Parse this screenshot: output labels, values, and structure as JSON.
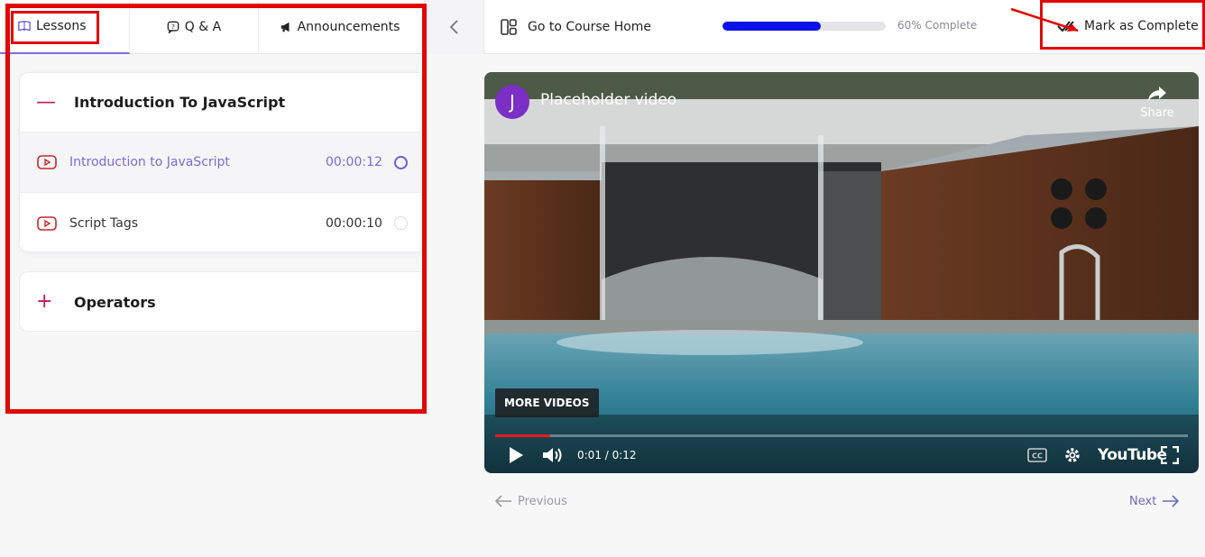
{
  "tabs": [
    {
      "label": "Lessons",
      "icon": "book-icon"
    },
    {
      "label": "Q & A",
      "icon": "chat-icon"
    },
    {
      "label": "Announcements",
      "icon": "megaphone-icon"
    }
  ],
  "header": {
    "collapse_icon": "chevron-left-icon",
    "course_home_label": "Go to Course Home",
    "course_home_icon": "layout-icon",
    "progress_percent": 60,
    "progress_text": "60% Complete",
    "mark_complete_label": "Mark as Complete",
    "mark_complete_icon": "check-icon"
  },
  "sections": [
    {
      "title": "Introduction To JavaScript",
      "expanded_sign": "—",
      "lessons": [
        {
          "title": "Introduction to JavaScript",
          "duration": "00:00:12",
          "active": true
        },
        {
          "title": "Script Tags",
          "duration": "00:00:10",
          "active": false
        }
      ]
    },
    {
      "title": "Operators",
      "collapsed_sign": "+"
    }
  ],
  "video": {
    "channel_initial": "J",
    "title": "Placeholder video",
    "share_label": "Share",
    "more_videos_label": "MORE VIDEOS",
    "time": "0:01 / 0:12",
    "progress_fraction": 0.08,
    "brand": "YouTube"
  },
  "footer": {
    "previous_label": "Previous",
    "next_label": "Next"
  },
  "colors": {
    "accent": "#7a6ad6",
    "progress": "#0a12e6",
    "annotation": "#e10600",
    "section_sign": "#c2185b"
  }
}
